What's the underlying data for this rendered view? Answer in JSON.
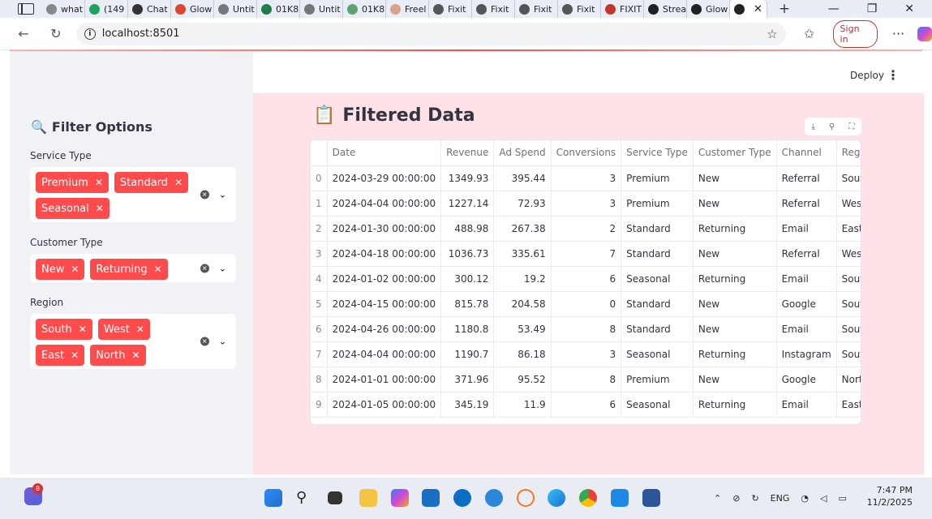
{
  "browser": {
    "tabs": [
      {
        "label": "what",
        "color": "#888888"
      },
      {
        "label": "(149",
        "color": "#1ea35c"
      },
      {
        "label": "Chat",
        "color": "#333333"
      },
      {
        "label": "Glow",
        "color": "#d9482e"
      },
      {
        "label": "Untit",
        "color": "#777777"
      },
      {
        "label": "01K8",
        "color": "#1e7e45"
      },
      {
        "label": "Untit",
        "color": "#777777"
      },
      {
        "label": "01K8",
        "color": "#5aa56e"
      },
      {
        "label": "Freel",
        "color": "#d8a38a"
      },
      {
        "label": "Fixit",
        "color": "#555555"
      },
      {
        "label": "Fixit",
        "color": "#555555"
      },
      {
        "label": "Fixit",
        "color": "#555555"
      },
      {
        "label": "Fixit",
        "color": "#555555"
      },
      {
        "label": "FIXIT",
        "color": "#c0392b"
      },
      {
        "label": "Strea",
        "color": "#222222"
      },
      {
        "label": "Glow",
        "color": "#222222"
      }
    ],
    "url": "localhost:8501",
    "sign_in": "Sign in"
  },
  "header": {
    "deploy": "Deploy"
  },
  "sidebar": {
    "title": "Filter Options",
    "title_icon": "🔍",
    "filters": [
      {
        "label": "Service Type",
        "chips": [
          "Premium",
          "Standard",
          "Seasonal"
        ]
      },
      {
        "label": "Customer Type",
        "chips": [
          "New",
          "Returning"
        ]
      },
      {
        "label": "Region",
        "chips": [
          "South",
          "West",
          "East",
          "North"
        ]
      }
    ]
  },
  "main": {
    "title": "Filtered Data",
    "title_icon": "📋",
    "table": {
      "columns": [
        "",
        "Date",
        "Revenue",
        "Ad Spend",
        "Conversions",
        "Service Type",
        "Customer Type",
        "Channel",
        "Region"
      ],
      "rows": [
        [
          "0",
          "2024-03-29 00:00:00",
          "1349.93",
          "395.44",
          "3",
          "Premium",
          "New",
          "Referral",
          "South"
        ],
        [
          "1",
          "2024-04-04 00:00:00",
          "1227.14",
          "72.93",
          "3",
          "Premium",
          "New",
          "Referral",
          "West"
        ],
        [
          "2",
          "2024-01-30 00:00:00",
          "488.98",
          "267.38",
          "2",
          "Standard",
          "Returning",
          "Email",
          "East"
        ],
        [
          "3",
          "2024-04-18 00:00:00",
          "1036.73",
          "335.61",
          "7",
          "Standard",
          "New",
          "Referral",
          "West"
        ],
        [
          "4",
          "2024-01-02 00:00:00",
          "300.12",
          "19.2",
          "6",
          "Seasonal",
          "Returning",
          "Email",
          "South"
        ],
        [
          "5",
          "2024-04-15 00:00:00",
          "815.78",
          "204.58",
          "0",
          "Standard",
          "New",
          "Google",
          "South"
        ],
        [
          "6",
          "2024-04-26 00:00:00",
          "1180.8",
          "53.49",
          "8",
          "Standard",
          "New",
          "Email",
          "South"
        ],
        [
          "7",
          "2024-04-04 00:00:00",
          "1190.7",
          "86.18",
          "3",
          "Seasonal",
          "Returning",
          "Instagram",
          "South"
        ],
        [
          "8",
          "2024-01-01 00:00:00",
          "371.96",
          "95.52",
          "8",
          "Premium",
          "New",
          "Google",
          "North"
        ],
        [
          "9",
          "2024-01-05 00:00:00",
          "345.19",
          "11.9",
          "6",
          "Seasonal",
          "Returning",
          "Email",
          "East"
        ]
      ]
    }
  },
  "taskbar": {
    "badge": "8",
    "lang": "ENG",
    "time": "7:47 PM",
    "date": "11/2/2025"
  }
}
